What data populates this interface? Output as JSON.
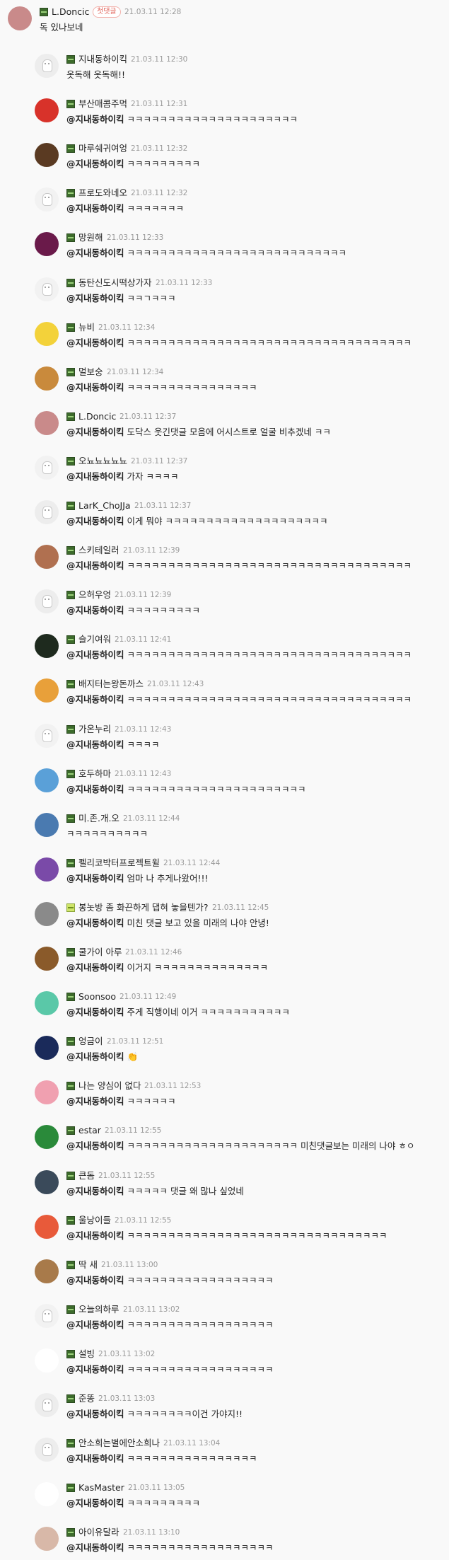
{
  "parent": {
    "author": "L.Doncic",
    "badge": "첫댓글",
    "time": "21.03.11 12:28",
    "text": "독 있나보네"
  },
  "replies": [
    {
      "author": "지내동하이킥",
      "time": "21.03.11 12:30",
      "mention": "",
      "text": "옷독해 옷독해!!",
      "avatar": "#ededed",
      "ghost": true
    },
    {
      "author": "부산매콤주먹",
      "time": "21.03.11 12:31",
      "mention": "@지내동하이킥",
      "text": "ㅋㅋㅋㅋㅋㅋㅋㅋㅋㅋㅋㅋㅋㅋㅋㅋㅋㅋㅋㅋㅋ",
      "avatar": "#d8322a"
    },
    {
      "author": "마루쉐귀여엉",
      "time": "21.03.11 12:32",
      "mention": "@지내동하이킥",
      "text": "ㅋㅋㅋㅋㅋㅋㅋㅋㅋ",
      "avatar": "#5a3a22"
    },
    {
      "author": "프로도와네오",
      "time": "21.03.11 12:32",
      "mention": "@지내동하이킥",
      "text": "ㅋㅋㅋㅋㅋㅋㅋ",
      "avatar": "#f2f2f2",
      "ghost": true
    },
    {
      "author": "망원해",
      "time": "21.03.11 12:33",
      "mention": "@지내동하이킥",
      "text": "ㅋㅋㅋㅋㅋㅋㅋㅋㅋㅋㅋㅋㅋㅋㅋㅋㅋㅋㅋㅋㅋㅋㅋㅋㅋㅋㅋ",
      "avatar": "#6a1a4a"
    },
    {
      "author": "동탄신도시떡상가자",
      "time": "21.03.11 12:33",
      "mention": "@지내동하이킥",
      "text": "ㅋㅋㄱㅋㅋㅋ",
      "avatar": "#f2f2f2",
      "ghost": true
    },
    {
      "author": "뉴비",
      "time": "21.03.11 12:34",
      "mention": "@지내동하이킥",
      "text": "ㅋㅋㅋㅋㅋㅋㅋㅋㅋㅋㅋㅋㅋㅋㅋㅋㅋㅋㅋㅋㅋㅋㅋㅋㅋㅋㅋㅋㅋㅋㅋㅋㅋㅋㅋ",
      "avatar": "#f3d23a"
    },
    {
      "author": "멀보숭",
      "time": "21.03.11 12:34",
      "mention": "@지내동하이킥",
      "text": "ㅋㅋㅋㅋㅋㅋㅋㅋㅋㅋㅋㅋㅋㅋㅋㅋ",
      "avatar": "#c98a3c"
    },
    {
      "author": "L.Doncic",
      "time": "21.03.11 12:37",
      "mention": "@지내동하이킥",
      "text": "도닥스 웃긴댓글 모음에 어시스트로 얼굴 비추겠네 ㅋㅋ",
      "avatar": "#c98a8a"
    },
    {
      "author": "오뇨뇨뇨뇨뇨",
      "time": "21.03.11 12:37",
      "mention": "@지내동하이킥",
      "text": "가자 ㅋㅋㅋㅋ",
      "avatar": "#f2f2f2",
      "ghost": true
    },
    {
      "author": "LarK_ChoJJa",
      "time": "21.03.11 12:37",
      "mention": "@지내동하이킥",
      "text": "이게 뭐야 ㅋㅋㅋㅋㅋㅋㅋㅋㅋㅋㅋㅋㅋㅋㅋㅋㅋㅋㅋㅋ",
      "avatar": "#ededed",
      "ghost": true
    },
    {
      "author": "스키테일러",
      "time": "21.03.11 12:39",
      "mention": "@지내동하이킥",
      "text": "ㅋㅋㅋㅋㅋㅋㅋㅋㅋㅋㅋㅋㅋㅋㅋㅋㅋㅋㅋㅋㅋㅋㅋㅋㅋㅋㅋㅋㅋㅋㅋㅋㅋㅋㅋ",
      "avatar": "#b07050"
    },
    {
      "author": "으허우엉",
      "time": "21.03.11 12:39",
      "mention": "@지내동하이킥",
      "text": "ㅋㅋㅋㅋㅋㅋㅋㅋㅋ",
      "avatar": "#ededed",
      "ghost": true
    },
    {
      "author": "슬기여워",
      "time": "21.03.11 12:41",
      "mention": "@지내동하이킥",
      "text": "ㅋㅋㅋㅋㅋㅋㅋㅋㅋㅋㅋㅋㅋㅋㅋㅋㅋㅋㅋㅋㅋㅋㅋㅋㅋㅋㅋㅋㅋㅋㅋㅋㅋㅋㅋ",
      "avatar": "#1e2a1e"
    },
    {
      "author": "배지터는왕돈까스",
      "time": "21.03.11 12:43",
      "mention": "@지내동하이킥",
      "text": "ㅋㅋㅋㅋㅋㅋㅋㅋㅋㅋㅋㅋㅋㅋㅋㅋㅋㅋㅋㅋㅋㅋㅋㅋㅋㅋㅋㅋㅋㅋㅋㅋㅋㅋㅋ",
      "avatar": "#e8a03a"
    },
    {
      "author": "가온누리",
      "time": "21.03.11 12:43",
      "mention": "@지내동하이킥",
      "text": "ㅋㅋㅋㅋ",
      "avatar": "#f2f2f2",
      "ghost": true
    },
    {
      "author": "호두하마",
      "time": "21.03.11 12:43",
      "mention": "@지내동하이킥",
      "text": "ㅋㅋㅋㅋㅋㅋㅋㅋㅋㅋㅋㅋㅋㅋㅋㅋㅋㅋㅋㅋㅋㅋ",
      "avatar": "#5aa0d8"
    },
    {
      "author": "미.존.개.오",
      "time": "21.03.11 12:44",
      "mention": "",
      "text": "ㅋㅋㅋㅋㅋㅋㅋㅋㅋㅋ",
      "avatar": "#4a7ab0"
    },
    {
      "author": "펠리코박터프로젝트윌",
      "time": "21.03.11 12:44",
      "mention": "@지내동하이킥",
      "text": "엄마 나 추게나왔어!!!",
      "avatar": "#7a4aa8"
    },
    {
      "author": "봉놋방 좀 화끈하게 댑혀 놓을텐가?",
      "time": "21.03.11 12:45",
      "mention": "@지내동하이킥",
      "text": "미친 댓글 보고 있을 미래의 나야 안녕!",
      "avatar": "#8a8a8a",
      "green": true
    },
    {
      "author": "쿨가이 아루",
      "time": "21.03.11 12:46",
      "mention": "@지내동하이킥",
      "text": "이거지 ㅋㅋㅋㅋㅋㅋㅋㅋㅋㅋㅋㅋㅋㅋ",
      "avatar": "#8a5a2a"
    },
    {
      "author": "Soonsoo",
      "time": "21.03.11 12:49",
      "mention": "@지내동하이킥",
      "text": "주게 직행이네 이거 ㅋㅋㅋㅋㅋㅋㅋㅋㅋㅋㅋ",
      "avatar": "#5ac8a8"
    },
    {
      "author": "엉금이",
      "time": "21.03.11 12:51",
      "mention": "@지내동하이킥",
      "text": "👏",
      "avatar": "#1a2a5a"
    },
    {
      "author": "나는 양심이 없다",
      "time": "21.03.11 12:53",
      "mention": "@지내동하이킥",
      "text": "ㅋㅋㅋㅋㅋㅋ",
      "avatar": "#f0a0b0"
    },
    {
      "author": "estar",
      "time": "21.03.11 12:55",
      "mention": "@지내동하이킥",
      "text": "ㅋㅋㅋㅋㅋㅋㅋㅋㅋㅋㅋㅋㅋㅋㅋㅋㅋㅋㅋㅋㅋ 미친댓글보는 미래의 나야 ㅎㅇ",
      "avatar": "#2a8a3a"
    },
    {
      "author": "큰돔",
      "time": "21.03.11 12:55",
      "mention": "@지내동하이킥",
      "text": "ㅋㅋㅋㅋㅋ 댓글 왜 많나 싶었네",
      "avatar": "#3a4a5a"
    },
    {
      "author": "울낭이들",
      "time": "21.03.11 12:55",
      "mention": "@지내동하이킥",
      "text": "ㅋㅋㅋㅋㅋㅋㅋㅋㅋㅋㅋㅋㅋㅋㅋㅋㅋㅋㅋㅋㅋㅋㅋㅋㅋㅋㅋㅋㅋㅋㅋㅋ",
      "avatar": "#e85a3a"
    },
    {
      "author": "딱 새",
      "time": "21.03.11 13:00",
      "mention": "@지내동하이킥",
      "text": "ㅋㅋㅋㅋㅋㅋㅋㅋㅋㅋㅋㅋㅋㅋㅋㅋㅋㅋ",
      "avatar": "#a87a4a"
    },
    {
      "author": "오늘의하루",
      "time": "21.03.11 13:02",
      "mention": "@지내동하이킥",
      "text": "ㅋㅋㅋㅋㅋㅋㅋㅋㅋㅋㅋㅋㅋㅋㅋㅋㅋㅋ",
      "avatar": "#f2f2f2",
      "ghost": true
    },
    {
      "author": "설빙",
      "time": "21.03.11 13:02",
      "mention": "@지내동하이킥",
      "text": "ㅋㅋㅋㅋㅋㅋㅋㅋㅋㅋㅋㅋㅋㅋㅋㅋㅋㅋ",
      "avatar": "#ffffff"
    },
    {
      "author": "준똥",
      "time": "21.03.11 13:03",
      "mention": "@지내동하이킥",
      "text": "ㅋㅋㅋㅋㅋㅋㅋㅋ이건 가야지!!",
      "avatar": "#ededed",
      "ghost": true
    },
    {
      "author": "안소희는별에안소희나",
      "time": "21.03.11 13:04",
      "mention": "@지내동하이킥",
      "text": "ㅋㅋㅋㅋㅋㅋㅋㅋㅋㅋㅋㅋㅋㅋㅋㅋ",
      "avatar": "#ededed",
      "ghost": true
    },
    {
      "author": "KasMaster",
      "time": "21.03.11 13:05",
      "mention": "@지내동하이킥",
      "text": "ㅋㅋㅋㅋㅋㅋㅋㅋㅋ",
      "avatar": "#ffffff"
    },
    {
      "author": "아이유달라",
      "time": "21.03.11 13:10",
      "mention": "@지내동하이킥",
      "text": "ㅋㅋㅋㅋㅋㅋㅋㅋㅋㅋㅋㅋㅋㅋㅋㅋㅋㅋ",
      "avatar": "#d8b8a8"
    }
  ]
}
